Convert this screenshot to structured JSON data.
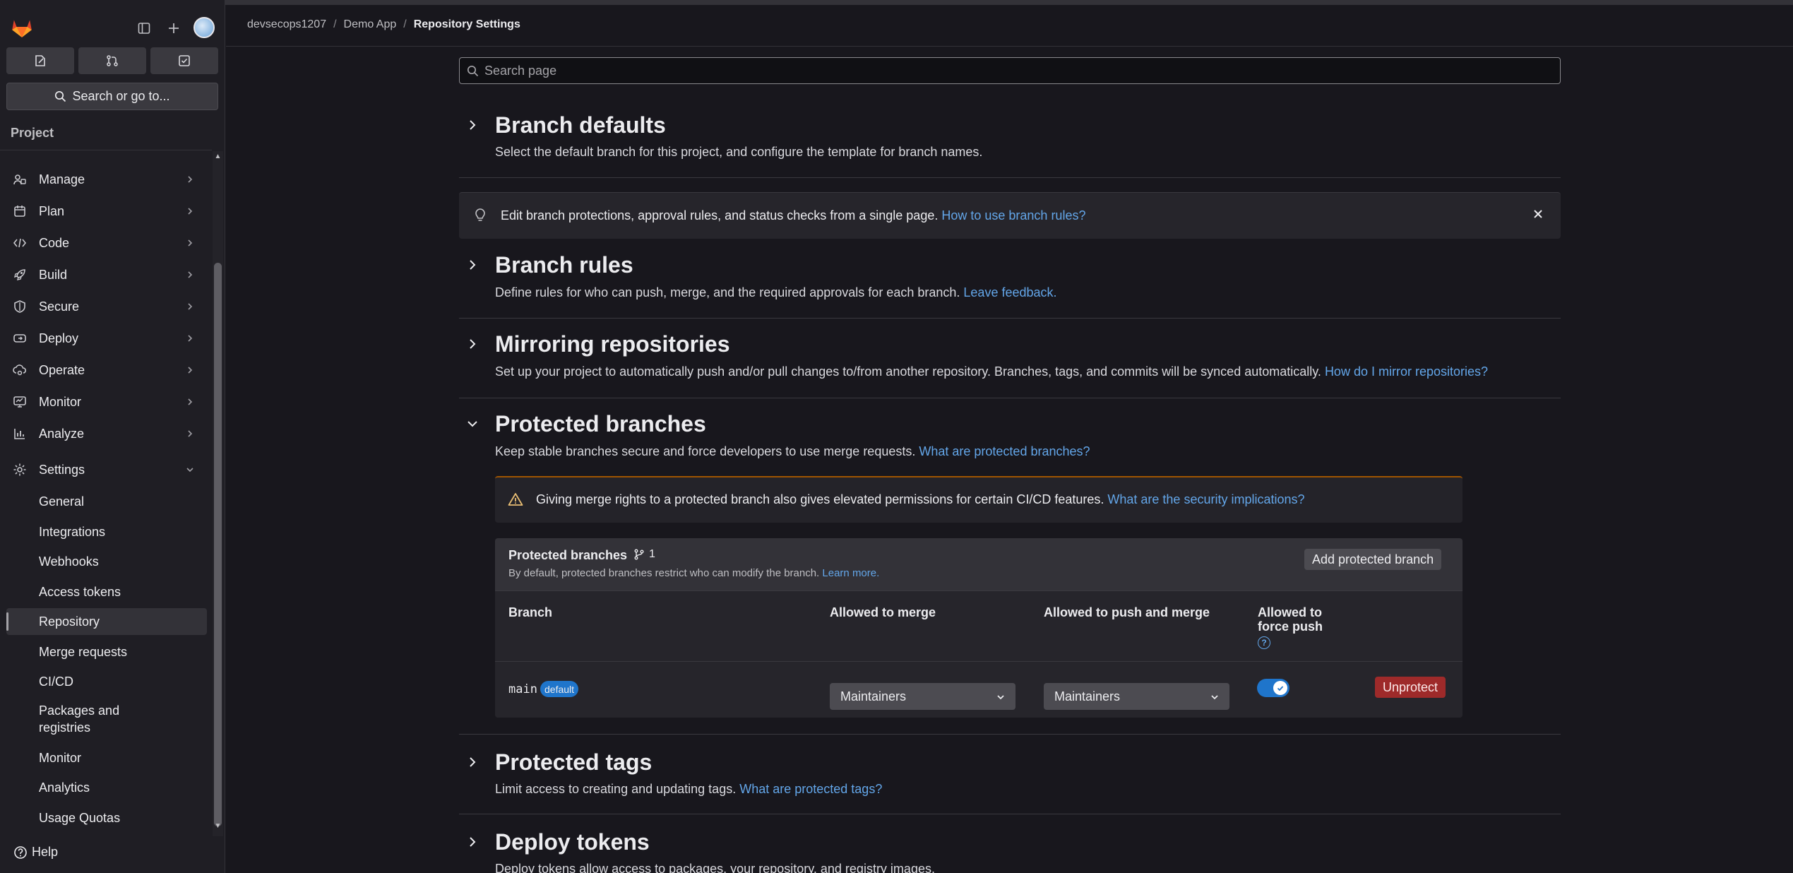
{
  "sidebar": {
    "search_label": "Search or go to...",
    "section_label": "Project",
    "nav": [
      {
        "label": "Manage",
        "icon": "users-icon"
      },
      {
        "label": "Plan",
        "icon": "calendar-icon"
      },
      {
        "label": "Code",
        "icon": "code-icon"
      },
      {
        "label": "Build",
        "icon": "rocket-icon"
      },
      {
        "label": "Secure",
        "icon": "shield-icon"
      },
      {
        "label": "Deploy",
        "icon": "deploy-icon"
      },
      {
        "label": "Operate",
        "icon": "cloud-gear-icon"
      },
      {
        "label": "Monitor",
        "icon": "monitor-icon"
      },
      {
        "label": "Analyze",
        "icon": "chart-icon"
      },
      {
        "label": "Settings",
        "icon": "gear-icon"
      }
    ],
    "settings_sub": [
      {
        "label": "General"
      },
      {
        "label": "Integrations"
      },
      {
        "label": "Webhooks"
      },
      {
        "label": "Access tokens"
      },
      {
        "label": "Repository"
      },
      {
        "label": "Merge requests"
      },
      {
        "label": "CI/CD"
      },
      {
        "label": "Packages and registries"
      },
      {
        "label": "Monitor"
      },
      {
        "label": "Analytics"
      },
      {
        "label": "Usage Quotas"
      }
    ],
    "active_sub": "Repository",
    "help_label": "Help"
  },
  "breadcrumb": {
    "items": [
      "devsecops1207",
      "Demo App"
    ],
    "current": "Repository Settings"
  },
  "search": {
    "placeholder": "Search page"
  },
  "sections": {
    "branch_defaults": {
      "title": "Branch defaults",
      "desc": "Select the default branch for this project, and configure the template for branch names."
    },
    "info_alert": {
      "text": "Edit branch protections, approval rules, and status checks from a single page.",
      "link": "How to use branch rules?"
    },
    "branch_rules": {
      "title": "Branch rules",
      "desc": "Define rules for who can push, merge, and the required approvals for each branch.",
      "link": "Leave feedback."
    },
    "mirroring": {
      "title": "Mirroring repositories",
      "desc": "Set up your project to automatically push and/or pull changes to/from another repository. Branches, tags, and commits will be synced automatically.",
      "link": "How do I mirror repositories?"
    },
    "protected_branches": {
      "title": "Protected branches",
      "desc": "Keep stable branches secure and force developers to use merge requests.",
      "link": "What are protected branches?",
      "warning_text": "Giving merge rights to a protected branch also gives elevated permissions for certain CI/CD features.",
      "warning_link": "What are the security implications?",
      "card": {
        "title": "Protected branches",
        "count": "1",
        "desc": "By default, protected branches restrict who can modify the branch.",
        "desc_link": "Learn more.",
        "add_button": "Add protected branch",
        "columns": {
          "branch": "Branch",
          "merge": "Allowed to merge",
          "push_merge": "Allowed to push and merge",
          "force_push_1": "Allowed to",
          "force_push_2": "force push"
        },
        "row": {
          "branch": "main",
          "badge": "default",
          "merge_value": "Maintainers",
          "push_value": "Maintainers",
          "force_push": true,
          "unprotect": "Unprotect"
        }
      }
    },
    "protected_tags": {
      "title": "Protected tags",
      "desc": "Limit access to creating and updating tags.",
      "link": "What are protected tags?"
    },
    "deploy_tokens": {
      "title": "Deploy tokens",
      "desc": "Deploy tokens allow access to packages, your repository, and registry images."
    }
  },
  "colors": {
    "background": "#18171d",
    "sidebar": "#1f1e24",
    "link": "#63a6e9",
    "toggle_on": "#1f75cb",
    "danger": "#9e2a2a",
    "warning": "#9e5400"
  }
}
